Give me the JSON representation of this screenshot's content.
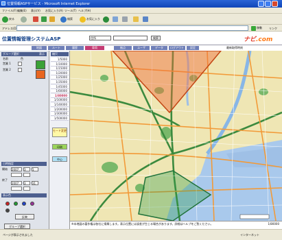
{
  "window": {
    "title": "位置情報ASPサービス - Microsoft Internet Explorer"
  },
  "menubar": {
    "items": [
      "ファイル(F)",
      "編集(E)",
      "表示(V)",
      "お気に入り(A)",
      "ツール(T)",
      "ヘルプ(H)"
    ]
  },
  "toolbar": {
    "back_label": "戻る",
    "search_label": "検索",
    "favorites_label": "お気に入り"
  },
  "addressbar": {
    "label": "アドレス(D)",
    "go_label": "移動",
    "links_label": "リンク"
  },
  "app": {
    "logo": "位置情報管理システムASP",
    "search_select": "住所",
    "search_button": "検索",
    "brand_prefix": "ナビ",
    "brand_suffix": ".com"
  },
  "tabs": [
    {
      "label": "地図",
      "active": false
    },
    {
      "label": "ルート",
      "active": false
    },
    {
      "label": "履歴",
      "active": false
    },
    {
      "label": "車両",
      "active": true
    },
    {
      "label": "拠点",
      "active": false
    },
    {
      "label": "ユーザ",
      "active": false
    },
    {
      "label": "データ",
      "active": false
    },
    {
      "label": "ログアウト",
      "active": false
    },
    {
      "label": "設定",
      "active": false
    }
  ],
  "tab_info": "最新取得時刻",
  "left_panel": {
    "vehicle_header": "グループ選択",
    "vehicle_header_right": "表示",
    "col_name": "名前",
    "col_color": "色",
    "vehicles": [
      {
        "name": "営業 1",
        "color": "#3aa136"
      },
      {
        "name": "営業 2",
        "color": "#e8651f"
      }
    ],
    "date_header": "日時指定",
    "date_from_label": "開始",
    "date_to_label": "終了",
    "date_from": [
      "2007",
      "3",
      "1"
    ],
    "date_to": [
      "2007",
      "3",
      "31"
    ],
    "time_label": "時刻",
    "color_header": "表示色",
    "color_dots": [
      "#cc2222",
      "#229933",
      "#2244cc",
      "#993399",
      "#444444"
    ],
    "apply_button": "反映",
    "group_button": "グループ選択"
  },
  "zoom": {
    "header": "縮尺",
    "levels": [
      "1/5000",
      "1/10000",
      "1/15000",
      "1/20000",
      "1/25000",
      "1/35000",
      "1/45000",
      "1/60000",
      "1/80000",
      "1/100000",
      "1/140000",
      "1/200000",
      "1/300000",
      "1/500000"
    ],
    "selected_index": 8,
    "button_mode": "モード変更",
    "button_print": "印刷",
    "button_center": "中心"
  },
  "footer": {
    "text": "※本地図の著作権は各社に帰属します。表示位置には誤差が生じる場合があります。詳細はヘルプをご覧ください。",
    "scale": "1/80000"
  },
  "statusbar": {
    "done": "ページが表示されました",
    "zone": "インターネット"
  }
}
